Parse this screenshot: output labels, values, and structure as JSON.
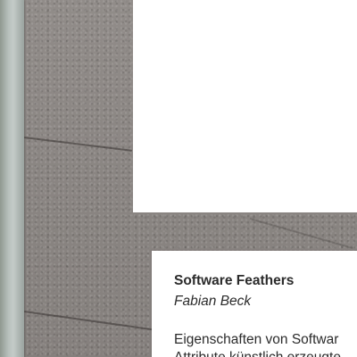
{
  "card": {
    "title": "Software Feathers",
    "author": "Fabian Beck",
    "body_line_1": "Eigenschaften von Softwar",
    "body_line_2": "Attribute künstlich erzeugte"
  },
  "colors": {
    "pavement": "#8c8784",
    "post": "#b7c0bc",
    "paper": "#ffffff",
    "text": "#2b2b2b"
  }
}
